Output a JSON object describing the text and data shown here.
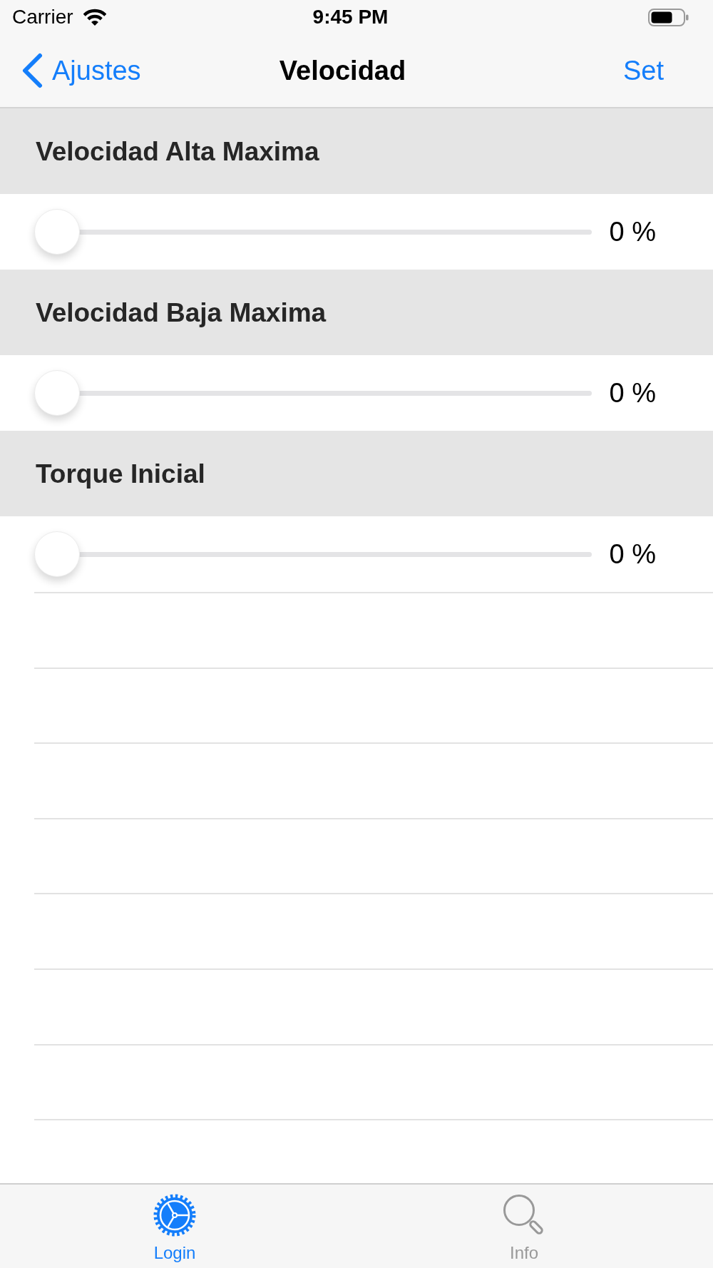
{
  "status_bar": {
    "carrier": "Carrier",
    "time": "9:45 PM"
  },
  "nav_bar": {
    "back": "Ajustes",
    "title": "Velocidad",
    "action": "Set"
  },
  "sections": [
    {
      "title": "Velocidad Alta Maxima",
      "slider": {
        "level": 0,
        "reading": "0 %"
      }
    },
    {
      "title": "Velocidad Baja Maxima",
      "slider": {
        "level": 0,
        "reading": "0 %"
      }
    },
    {
      "title": "Torque Inicial",
      "slider": {
        "level": 0,
        "reading": "0 %"
      }
    }
  ],
  "tab_bar": {
    "items": [
      {
        "kind": "gear",
        "label": "Login",
        "selected": true
      },
      {
        "kind": "search",
        "label": "Info",
        "selected": false
      }
    ]
  }
}
